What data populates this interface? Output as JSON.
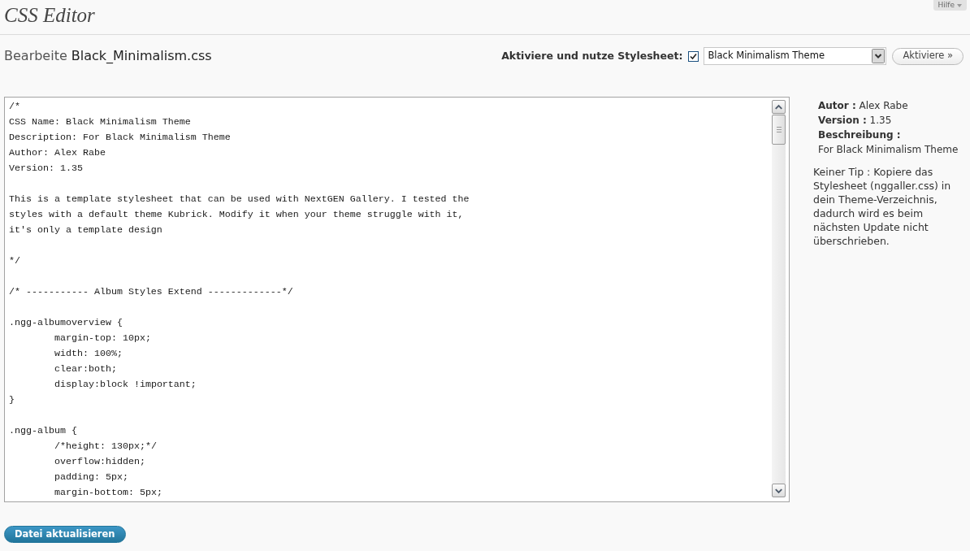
{
  "page": {
    "title": "CSS Editor",
    "help_tab": {
      "label": "Hilfe"
    }
  },
  "file_heading": {
    "prefix": "Bearbeite",
    "file": "Black_Minimalism.css"
  },
  "activation": {
    "label": "Aktiviere und nutze Stylesheet:",
    "checked": true,
    "stylesheet": "Black Minimalism Theme",
    "button": "Aktiviere »"
  },
  "editor": {
    "code": "/*\nCSS Name: Black Minimalism Theme\nDescription: For Black Minimalism Theme\nAuthor: Alex Rabe\nVersion: 1.35\n\nThis is a template stylesheet that can be used with NextGEN Gallery. I tested the\nstyles with a default theme Kubrick. Modify it when your theme struggle with it,\nit's only a template design\n\n*/\n\n/* ----------- Album Styles Extend -------------*/\n\n.ngg-albumoverview {\n\tmargin-top: 10px;\n\twidth: 100%;\n\tclear:both;\n\tdisplay:block !important;\n}\n\n.ngg-album {\n\t/*height: 130px;*/\n\toverflow:hidden;\n\tpadding: 5px;\n\tmargin-bottom: 5px;"
  },
  "info": {
    "meta": [
      {
        "kind": "inline",
        "label": "Autor :",
        "value": "Alex Rabe"
      },
      {
        "kind": "inline",
        "label": "Version :",
        "value": "1.35"
      },
      {
        "kind": "block",
        "label": "Beschreibung :",
        "value": "For Black Minimalism Theme"
      }
    ],
    "tip": "Keiner Tip : Kopiere das Stylesheet (nggaller.css) in dein Theme-Verzeichnis, dadurch wird es beim nächsten Update nicht überschrieben."
  },
  "submit_button": "Datei aktualisieren"
}
